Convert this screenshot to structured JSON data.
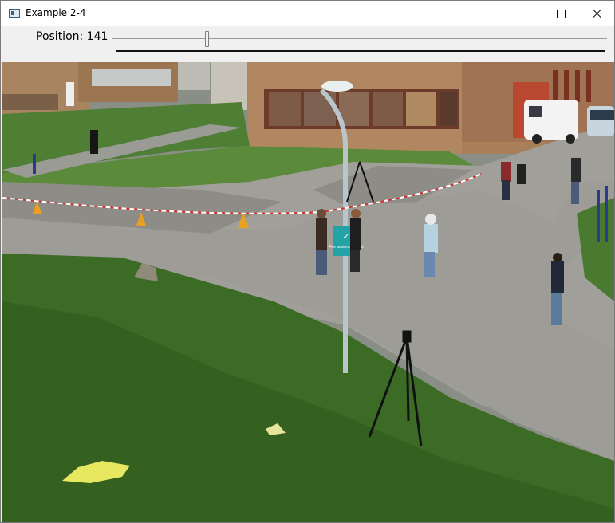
{
  "window": {
    "title": "Example 2-4",
    "icon": "app-window-icon",
    "controls": {
      "minimize": "minimize-icon",
      "maximize": "maximize-icon",
      "close": "close-icon"
    }
  },
  "toolbar": {
    "position_text": "Position: 141",
    "slider": {
      "value": 141,
      "fraction": 0.19
    }
  },
  "scene": {
    "sign_text": "Fire assembly point",
    "colors": {
      "grass": "#3c6b26",
      "road": "#9e9e9a",
      "sign": "#23a3a6",
      "brick": "#a97f5a"
    }
  }
}
